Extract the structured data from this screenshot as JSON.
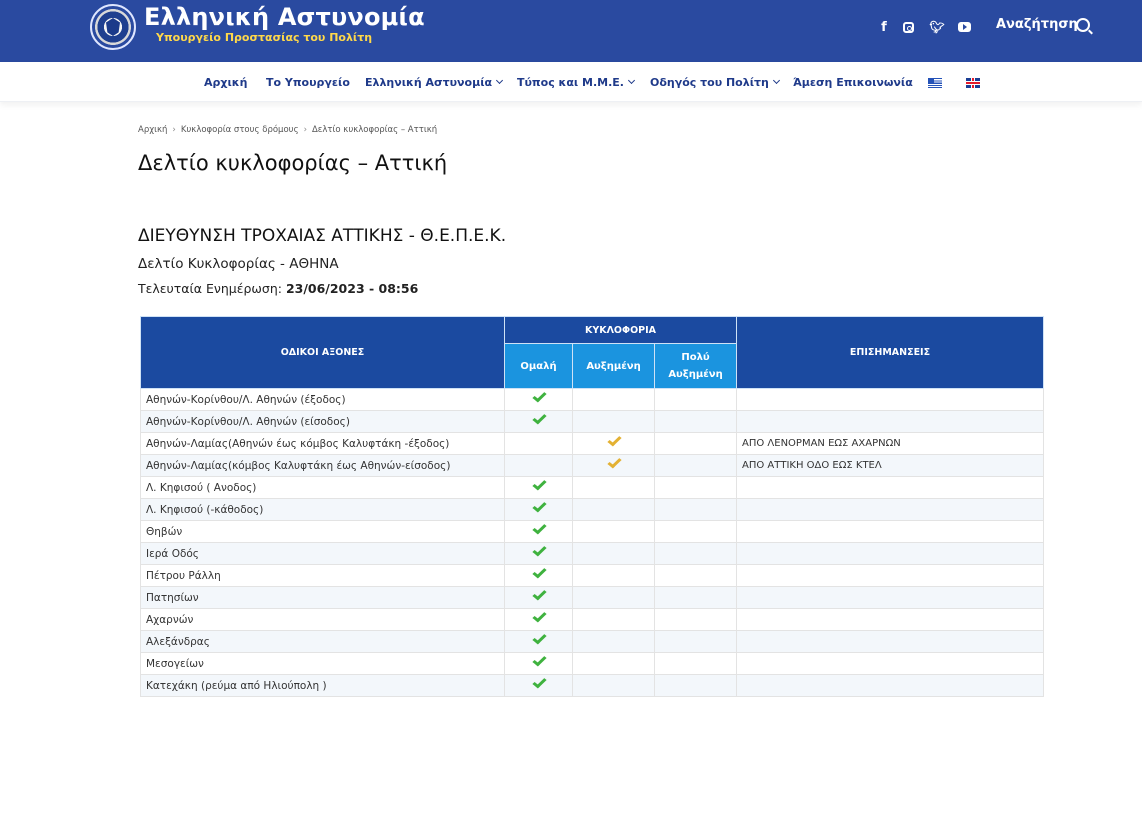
{
  "header": {
    "title": "Ελληνική Αστυνομία",
    "subtitle": "Υπουργείο Προστασίας του Πολίτη",
    "search_label": "Αναζήτηση",
    "socials": {
      "facebook": "f"
    },
    "brand_color": "#2a4aa0",
    "accent_color": "#ffd84a"
  },
  "nav": {
    "items": [
      {
        "label": "Αρχική",
        "has_dropdown": false
      },
      {
        "label": "Το Υπουργείο",
        "has_dropdown": false
      },
      {
        "label": "Ελληνική Αστυνομία",
        "has_dropdown": true
      },
      {
        "label": "Τύπος και Μ.Μ.Ε.",
        "has_dropdown": true
      },
      {
        "label": "Οδηγός του Πολίτη",
        "has_dropdown": true
      },
      {
        "label": "Άμεση Επικοινωνία",
        "has_dropdown": false
      }
    ],
    "flags": [
      "greek-flag-icon",
      "uk-flag-icon"
    ]
  },
  "breadcrumb": [
    "Αρχική",
    "Κυκλοφορία στους δρόμους",
    "Δελτίο κυκλοφορίας – Αττική"
  ],
  "page_title": "Δελτίο κυκλοφορίας – Αττική",
  "report": {
    "heading": "ΔΙΕΥΘΥΝΣΗ ΤΡΟΧΑΙΑΣ ΑΤΤΙΚΗΣ - Θ.Ε.Π.Ε.Κ.",
    "subheading": "Δελτίο Κυκλοφορίας - ΑΘΗΝΑ",
    "updated_label": "Τελευταία Ενημέρωση: ",
    "updated_value": "23/06/2023 - 08:56"
  },
  "table": {
    "col_roads": "ΟΔΙΚΟΙ ΑΞΟΝΕΣ",
    "col_traffic": "ΚΥΚΛΟΦΟΡΙΑ",
    "col_normal": "Ομαλή",
    "col_increased": "Αυξημένη",
    "col_very_increased": "Πολύ Αυξημένη",
    "col_notes": "ΕΠΙΣΗΜΑΝΣΕΙΣ",
    "level_colors": {
      "normal": "#3fb23f",
      "increased": "#e3b133"
    },
    "rows": [
      {
        "road": "Αθηνών-Κορίνθου/Λ. Αθηνών (έξοδος)",
        "level": "normal",
        "note": ""
      },
      {
        "road": "Αθηνών-Κορίνθου/Λ. Αθηνών (είσοδος)",
        "level": "normal",
        "note": ""
      },
      {
        "road": "Αθηνών-Λαμίας(Αθηνών έως κόμβος Καλυφτάκη -έξοδος)",
        "level": "increased",
        "note": "ΑΠΟ ΛΕΝΟΡΜΑΝ ΕΩΣ ΑΧΑΡΝΩΝ"
      },
      {
        "road": "Αθηνών-Λαμίας(κόμβος Καλυφτάκη έως Αθηνών-είσοδος)",
        "level": "increased",
        "note": "ΑΠΟ ΑΤΤΙΚΗ ΟΔΟ ΕΩΣ ΚΤΕΛ"
      },
      {
        "road": "Λ. Κηφισού ( Ανοδος)",
        "level": "normal",
        "note": ""
      },
      {
        "road": "Λ. Κηφισού (-κάθοδος)",
        "level": "normal",
        "note": ""
      },
      {
        "road": "Θηβών",
        "level": "normal",
        "note": ""
      },
      {
        "road": "Ιερά Οδός",
        "level": "normal",
        "note": ""
      },
      {
        "road": "Πέτρου Ράλλη",
        "level": "normal",
        "note": ""
      },
      {
        "road": "Πατησίων",
        "level": "normal",
        "note": ""
      },
      {
        "road": "Αχαρνών",
        "level": "normal",
        "note": ""
      },
      {
        "road": "Αλεξάνδρας",
        "level": "normal",
        "note": ""
      },
      {
        "road": "Μεσογείων",
        "level": "normal",
        "note": ""
      },
      {
        "road": "Κατεχάκη (ρεύμα από Ηλιούπολη )",
        "level": "normal",
        "note": ""
      }
    ]
  }
}
